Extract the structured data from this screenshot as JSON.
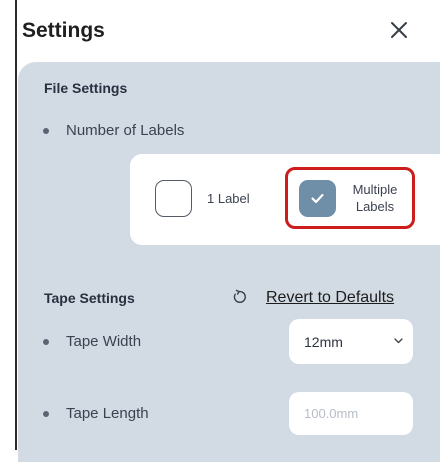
{
  "header": {
    "title": "Settings",
    "close_icon": "close-icon"
  },
  "file_settings": {
    "title": "File Settings",
    "number_of_labels": {
      "label": "Number of Labels",
      "options": [
        {
          "label": "1 Label",
          "selected": false
        },
        {
          "label": "Multiple Labels",
          "line1": "Multiple",
          "line2": "Labels",
          "selected": true
        }
      ]
    }
  },
  "tape_settings": {
    "title": "Tape Settings",
    "reset_icon": "reset-icon",
    "revert_label": "Revert to Defaults",
    "tape_width": {
      "label": "Tape Width",
      "value": "12mm"
    },
    "tape_length": {
      "label": "Tape Length",
      "value": "",
      "placeholder": "100.0mm"
    }
  },
  "colors": {
    "panel_bg": "#d2dbe4",
    "checkbox_selected": "#6f8ea7",
    "highlight": "#cc1c1c"
  }
}
